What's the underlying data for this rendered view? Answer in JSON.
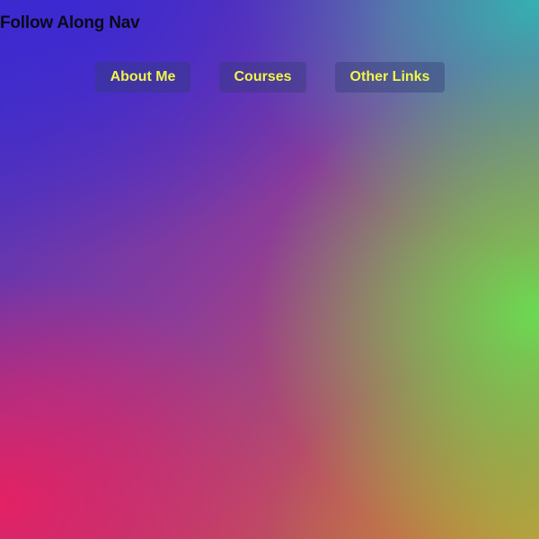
{
  "header": {
    "title": "Follow Along Nav"
  },
  "nav": {
    "items": [
      {
        "label": "About Me"
      },
      {
        "label": "Courses"
      },
      {
        "label": "Other Links"
      }
    ]
  },
  "colors": {
    "nav_text": "#f0f54a",
    "title_text": "#0a0a1a"
  }
}
